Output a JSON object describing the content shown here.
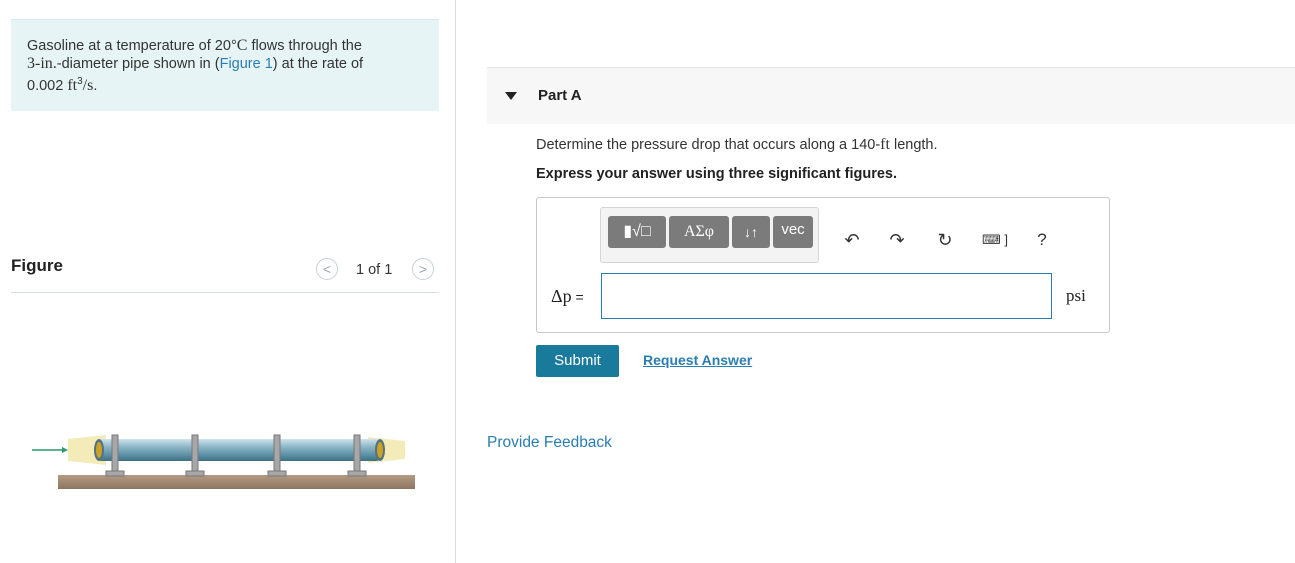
{
  "problem": {
    "text_1": "Gasoline at a temperature of 20",
    "deg": "°",
    "unit_c": "C",
    "text_2": " flows through the",
    "line2_in": "3-in.",
    "line2_rest": "-diameter pipe shown in (",
    "figure_link": "Figure 1",
    "line2_end": ") at the rate of",
    "rate_value": "0.002 ",
    "rate_unit": "ft",
    "rate_exp": "3",
    "rate_tail": "/s",
    "rate_end": "."
  },
  "figure": {
    "title": "Figure",
    "counter": "1 of 1",
    "prev": "<",
    "next": ">"
  },
  "part": {
    "title": "Part A"
  },
  "question": {
    "text_1": "Determine the pressure drop that occurs along a 140-",
    "unit": "ft",
    "text_2": " length.",
    "instruction": "Express your answer using three significant figures."
  },
  "toolbar": {
    "templates_label": "▮√□",
    "greek_label": "ΑΣφ",
    "arrows_label": "↓↑",
    "vec_label": "vec",
    "undo": "↶",
    "redo": "↷",
    "reset": "↻",
    "keyboard": "⌨ ]",
    "help": "?"
  },
  "answer": {
    "variable": "Δp",
    "equals": " =",
    "value": "",
    "unit": "psi"
  },
  "actions": {
    "submit": "Submit",
    "request": "Request Answer",
    "feedback": "Provide Feedback"
  },
  "colors": {
    "accent": "#1a7a9b",
    "link": "#2a7db1",
    "problem_bg": "#e6f4f6"
  }
}
